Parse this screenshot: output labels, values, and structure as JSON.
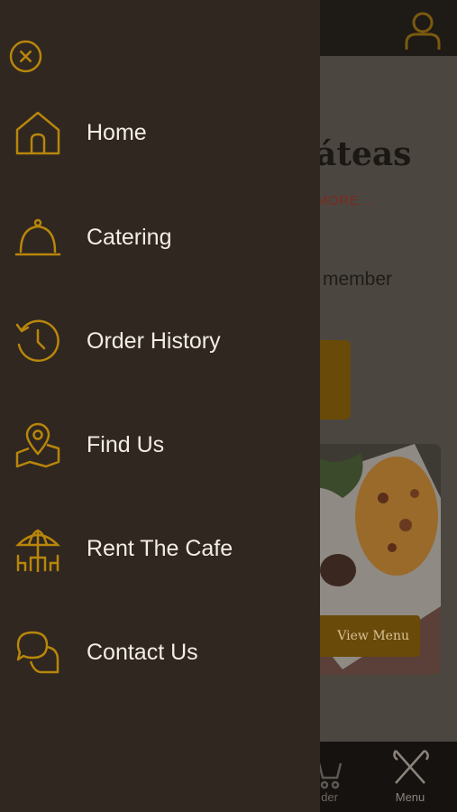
{
  "background": {
    "title_fragment": "áteas",
    "more_fragment": "MORE...",
    "member_fragment": "member",
    "view_menu_fragment": "View Menu",
    "order_tab_fragment": "der",
    "menu_tab_label": "Menu"
  },
  "drawer": {
    "close_icon": "close-circle-icon",
    "items": [
      {
        "label": "Home",
        "icon": "home-icon"
      },
      {
        "label": "Catering",
        "icon": "cloche-icon"
      },
      {
        "label": "Order History",
        "icon": "history-icon"
      },
      {
        "label": "Find Us",
        "icon": "map-pin-icon"
      },
      {
        "label": "Rent The Cafe",
        "icon": "patio-umbrella-icon"
      },
      {
        "label": "Contact Us",
        "icon": "chat-bubbles-icon"
      }
    ]
  },
  "colors": {
    "accent_gold": "#b8860b",
    "drawer_bg": "#2f2720",
    "label_text": "#f3ede4"
  }
}
